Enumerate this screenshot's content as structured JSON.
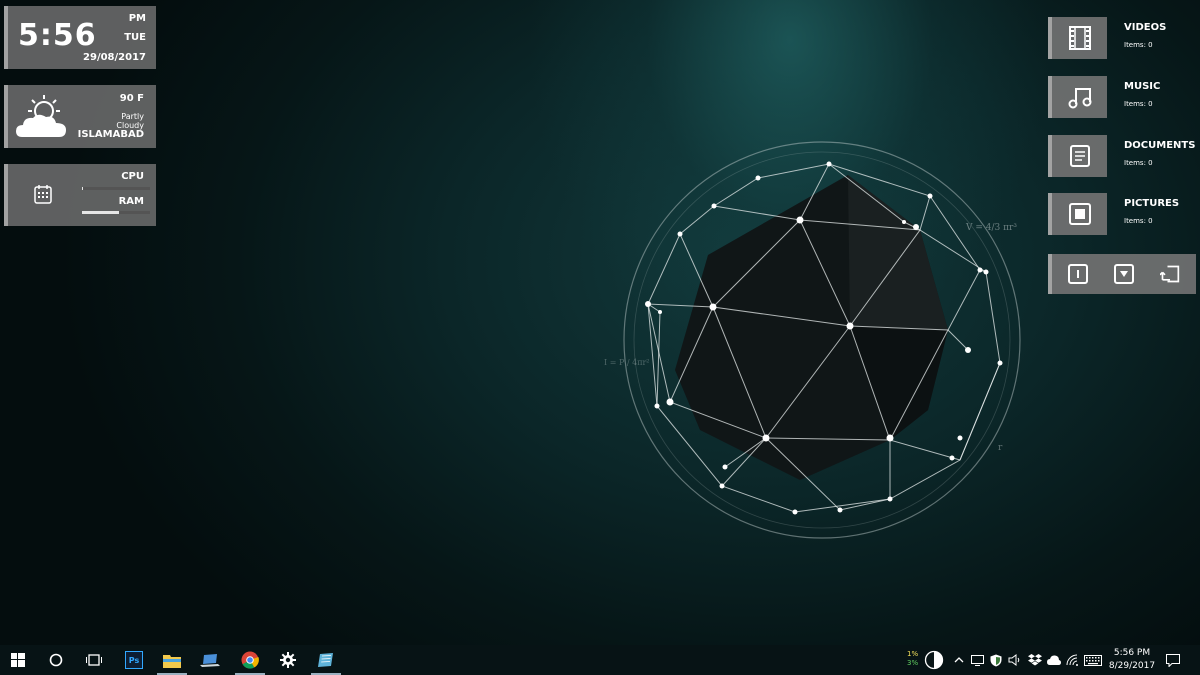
{
  "clock": {
    "time": "5:56",
    "ampm": "PM",
    "day": "TUE",
    "date": "29/08/2017"
  },
  "weather": {
    "temp": "90 F",
    "condition_line1": "Partly",
    "condition_line2": "Cloudy",
    "city": "ISLAMABAD",
    "icon": "partly-cloudy-icon"
  },
  "system": {
    "cpu_label": "CPU",
    "ram_label": "RAM",
    "cpu_level": 0.02,
    "ram_level": 0.55
  },
  "folders": [
    {
      "name": "VIDEOS",
      "count": "Items: 0",
      "icon": "film-icon"
    },
    {
      "name": "MUSIC",
      "count": "Items: 0",
      "icon": "music-note-icon"
    },
    {
      "name": "DOCUMENTS",
      "count": "Items: 0",
      "icon": "document-icon"
    },
    {
      "name": "PICTURES",
      "count": "Items: 0",
      "icon": "picture-icon"
    }
  ],
  "controls": [
    "power-icon",
    "dropdown-icon",
    "exit-icon"
  ],
  "wallpaper": {
    "formula1": "V = 4/3 πr³",
    "formula2": "I = P / 4πr²",
    "label_r": "r",
    "accent": "#1f6e6e"
  },
  "taskbar": {
    "apps": [
      "start-icon",
      "cortana-icon",
      "task-view-icon",
      "photoshop-icon",
      "file-explorer-icon",
      "laptop-app-icon",
      "chrome-icon",
      "settings-icon",
      "notepad-icon"
    ],
    "ps_label": "Ps",
    "tray": {
      "percent1": "1%",
      "percent2": "3%",
      "time": "5:56 PM",
      "date": "8/29/2017"
    }
  }
}
